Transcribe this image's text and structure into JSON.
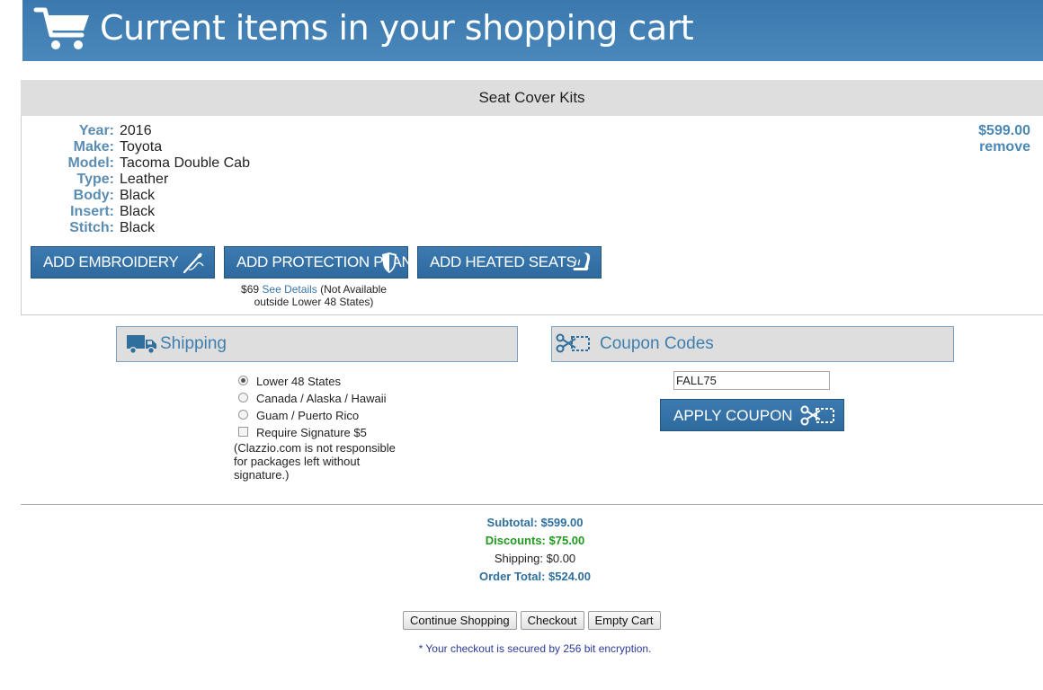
{
  "banner": {
    "title": "Current items in your shopping cart",
    "icon": "shopping-cart-icon"
  },
  "section": {
    "title": "Seat Cover Kits"
  },
  "item": {
    "specs": [
      {
        "label": "Year:",
        "value": "2016"
      },
      {
        "label": "Make:",
        "value": "Toyota"
      },
      {
        "label": "Model:",
        "value": "Tacoma Double Cab"
      },
      {
        "label": "Type:",
        "value": "Leather"
      },
      {
        "label": "Body:",
        "value": "Black"
      },
      {
        "label": "Insert:",
        "value": "Black"
      },
      {
        "label": "Stitch:",
        "value": "Black"
      }
    ],
    "price": "$599.00",
    "remove_label": "remove"
  },
  "addons": {
    "embroidery": {
      "label": "ADD EMBROIDERY",
      "icon": "needle-icon"
    },
    "protection": {
      "label": "ADD PROTECTION PLAN",
      "icon": "shield-icon"
    },
    "heated": {
      "label": "ADD HEATED SEATS",
      "icon": "heated-seat-icon"
    },
    "protection_note": {
      "price": "$69",
      "link": "See Details",
      "text": "(Not Available outside Lower 48 States)"
    }
  },
  "shipping": {
    "title": "Shipping",
    "icon": "truck-icon",
    "options": [
      {
        "label": "Lower 48 States",
        "selected": true
      },
      {
        "label": "Canada / Alaska / Hawaii",
        "selected": false
      },
      {
        "label": "Guam / Puerto Rico",
        "selected": false
      }
    ],
    "signature": {
      "label": "Require Signature $5",
      "checked": false,
      "note": "(Clazzio.com is not responsible for packages left without signature.)"
    }
  },
  "coupon": {
    "title": "Coupon Codes",
    "icon": "scissors-icon",
    "value": "FALL75",
    "apply_label": "APPLY COUPON"
  },
  "totals": {
    "subtotal": "Subtotal: $599.00",
    "discounts": "Discounts: $75.00",
    "shipping": "Shipping: $0.00",
    "order_total": "Order Total: $524.00"
  },
  "actions": {
    "continue": "Continue Shopping",
    "checkout": "Checkout",
    "empty": "Empty Cart"
  },
  "secure_note": "* Your checkout is secured by 256 bit encryption.",
  "colors": {
    "brand_blue": "#3a78ad",
    "discount_green": "#1f9a1f",
    "label_blue": "#5b8db2"
  }
}
